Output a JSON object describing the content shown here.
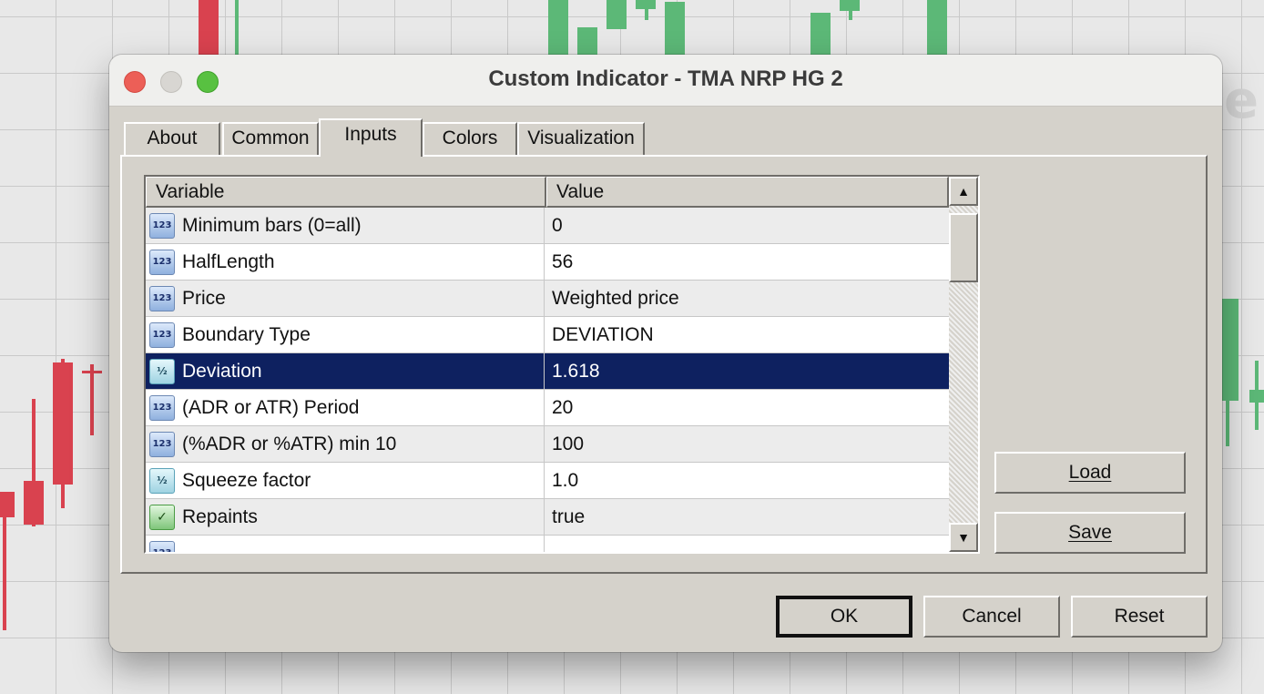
{
  "window": {
    "title": "Custom Indicator - TMA NRP HG 2"
  },
  "tabs": [
    {
      "label": "About"
    },
    {
      "label": "Common"
    },
    {
      "label": "Inputs"
    },
    {
      "label": "Colors"
    },
    {
      "label": "Visualization"
    }
  ],
  "active_tab": "Inputs",
  "table": {
    "columns": [
      "Variable",
      "Value"
    ],
    "rows": [
      {
        "icon": "integer-icon",
        "icon_text": "123",
        "variable": "Minimum bars (0=all)",
        "value": "0"
      },
      {
        "icon": "integer-icon",
        "icon_text": "123",
        "variable": "HalfLength",
        "value": "56"
      },
      {
        "icon": "integer-icon",
        "icon_text": "123",
        "variable": "Price",
        "value": "Weighted price"
      },
      {
        "icon": "integer-icon",
        "icon_text": "123",
        "variable": "Boundary Type",
        "value": "DEVIATION"
      },
      {
        "icon": "double-icon",
        "icon_text": "½",
        "variable": "Deviation",
        "value": "1.618",
        "selected": true
      },
      {
        "icon": "integer-icon",
        "icon_text": "123",
        "variable": "(ADR or ATR) Period",
        "value": "20"
      },
      {
        "icon": "integer-icon",
        "icon_text": "123",
        "variable": "(%ADR or %ATR) min 10",
        "value": "100"
      },
      {
        "icon": "double-icon",
        "icon_text": "½",
        "variable": "Squeeze factor",
        "value": "1.0"
      },
      {
        "icon": "boolean-icon",
        "icon_text": "✓",
        "variable": "Repaints",
        "value": "true"
      },
      {
        "icon": "integer-icon",
        "icon_text": "123",
        "variable": "",
        "value": ""
      }
    ]
  },
  "side_buttons": {
    "load": "Load",
    "save": "Save"
  },
  "footer_buttons": {
    "ok": "OK",
    "cancel": "Cancel",
    "reset": "Reset"
  },
  "colors": {
    "selection": "#0e2160",
    "candle_up": "#5cb877",
    "candle_down": "#d9424f"
  }
}
